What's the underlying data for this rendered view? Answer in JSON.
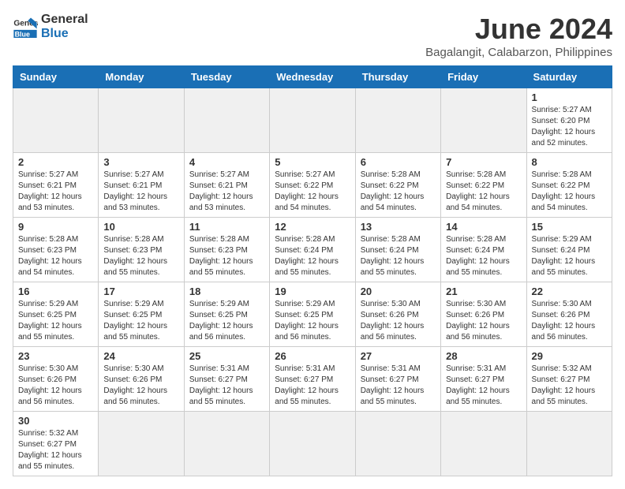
{
  "header": {
    "logo_general": "General",
    "logo_blue": "Blue",
    "month_title": "June 2024",
    "location": "Bagalangit, Calabarzon, Philippines"
  },
  "days_of_week": [
    "Sunday",
    "Monday",
    "Tuesday",
    "Wednesday",
    "Thursday",
    "Friday",
    "Saturday"
  ],
  "weeks": [
    [
      {
        "day": "",
        "info": ""
      },
      {
        "day": "",
        "info": ""
      },
      {
        "day": "",
        "info": ""
      },
      {
        "day": "",
        "info": ""
      },
      {
        "day": "",
        "info": ""
      },
      {
        "day": "",
        "info": ""
      },
      {
        "day": "1",
        "info": "Sunrise: 5:27 AM\nSunset: 6:20 PM\nDaylight: 12 hours\nand 52 minutes."
      }
    ],
    [
      {
        "day": "2",
        "info": "Sunrise: 5:27 AM\nSunset: 6:21 PM\nDaylight: 12 hours\nand 53 minutes."
      },
      {
        "day": "3",
        "info": "Sunrise: 5:27 AM\nSunset: 6:21 PM\nDaylight: 12 hours\nand 53 minutes."
      },
      {
        "day": "4",
        "info": "Sunrise: 5:27 AM\nSunset: 6:21 PM\nDaylight: 12 hours\nand 53 minutes."
      },
      {
        "day": "5",
        "info": "Sunrise: 5:27 AM\nSunset: 6:22 PM\nDaylight: 12 hours\nand 54 minutes."
      },
      {
        "day": "6",
        "info": "Sunrise: 5:28 AM\nSunset: 6:22 PM\nDaylight: 12 hours\nand 54 minutes."
      },
      {
        "day": "7",
        "info": "Sunrise: 5:28 AM\nSunset: 6:22 PM\nDaylight: 12 hours\nand 54 minutes."
      },
      {
        "day": "8",
        "info": "Sunrise: 5:28 AM\nSunset: 6:22 PM\nDaylight: 12 hours\nand 54 minutes."
      }
    ],
    [
      {
        "day": "9",
        "info": "Sunrise: 5:28 AM\nSunset: 6:23 PM\nDaylight: 12 hours\nand 54 minutes."
      },
      {
        "day": "10",
        "info": "Sunrise: 5:28 AM\nSunset: 6:23 PM\nDaylight: 12 hours\nand 55 minutes."
      },
      {
        "day": "11",
        "info": "Sunrise: 5:28 AM\nSunset: 6:23 PM\nDaylight: 12 hours\nand 55 minutes."
      },
      {
        "day": "12",
        "info": "Sunrise: 5:28 AM\nSunset: 6:24 PM\nDaylight: 12 hours\nand 55 minutes."
      },
      {
        "day": "13",
        "info": "Sunrise: 5:28 AM\nSunset: 6:24 PM\nDaylight: 12 hours\nand 55 minutes."
      },
      {
        "day": "14",
        "info": "Sunrise: 5:28 AM\nSunset: 6:24 PM\nDaylight: 12 hours\nand 55 minutes."
      },
      {
        "day": "15",
        "info": "Sunrise: 5:29 AM\nSunset: 6:24 PM\nDaylight: 12 hours\nand 55 minutes."
      }
    ],
    [
      {
        "day": "16",
        "info": "Sunrise: 5:29 AM\nSunset: 6:25 PM\nDaylight: 12 hours\nand 55 minutes."
      },
      {
        "day": "17",
        "info": "Sunrise: 5:29 AM\nSunset: 6:25 PM\nDaylight: 12 hours\nand 55 minutes."
      },
      {
        "day": "18",
        "info": "Sunrise: 5:29 AM\nSunset: 6:25 PM\nDaylight: 12 hours\nand 56 minutes."
      },
      {
        "day": "19",
        "info": "Sunrise: 5:29 AM\nSunset: 6:25 PM\nDaylight: 12 hours\nand 56 minutes."
      },
      {
        "day": "20",
        "info": "Sunrise: 5:30 AM\nSunset: 6:26 PM\nDaylight: 12 hours\nand 56 minutes."
      },
      {
        "day": "21",
        "info": "Sunrise: 5:30 AM\nSunset: 6:26 PM\nDaylight: 12 hours\nand 56 minutes."
      },
      {
        "day": "22",
        "info": "Sunrise: 5:30 AM\nSunset: 6:26 PM\nDaylight: 12 hours\nand 56 minutes."
      }
    ],
    [
      {
        "day": "23",
        "info": "Sunrise: 5:30 AM\nSunset: 6:26 PM\nDaylight: 12 hours\nand 56 minutes."
      },
      {
        "day": "24",
        "info": "Sunrise: 5:30 AM\nSunset: 6:26 PM\nDaylight: 12 hours\nand 56 minutes."
      },
      {
        "day": "25",
        "info": "Sunrise: 5:31 AM\nSunset: 6:27 PM\nDaylight: 12 hours\nand 55 minutes."
      },
      {
        "day": "26",
        "info": "Sunrise: 5:31 AM\nSunset: 6:27 PM\nDaylight: 12 hours\nand 55 minutes."
      },
      {
        "day": "27",
        "info": "Sunrise: 5:31 AM\nSunset: 6:27 PM\nDaylight: 12 hours\nand 55 minutes."
      },
      {
        "day": "28",
        "info": "Sunrise: 5:31 AM\nSunset: 6:27 PM\nDaylight: 12 hours\nand 55 minutes."
      },
      {
        "day": "29",
        "info": "Sunrise: 5:32 AM\nSunset: 6:27 PM\nDaylight: 12 hours\nand 55 minutes."
      }
    ],
    [
      {
        "day": "30",
        "info": "Sunrise: 5:32 AM\nSunset: 6:27 PM\nDaylight: 12 hours\nand 55 minutes."
      },
      {
        "day": "",
        "info": ""
      },
      {
        "day": "",
        "info": ""
      },
      {
        "day": "",
        "info": ""
      },
      {
        "day": "",
        "info": ""
      },
      {
        "day": "",
        "info": ""
      },
      {
        "day": "",
        "info": ""
      }
    ]
  ]
}
